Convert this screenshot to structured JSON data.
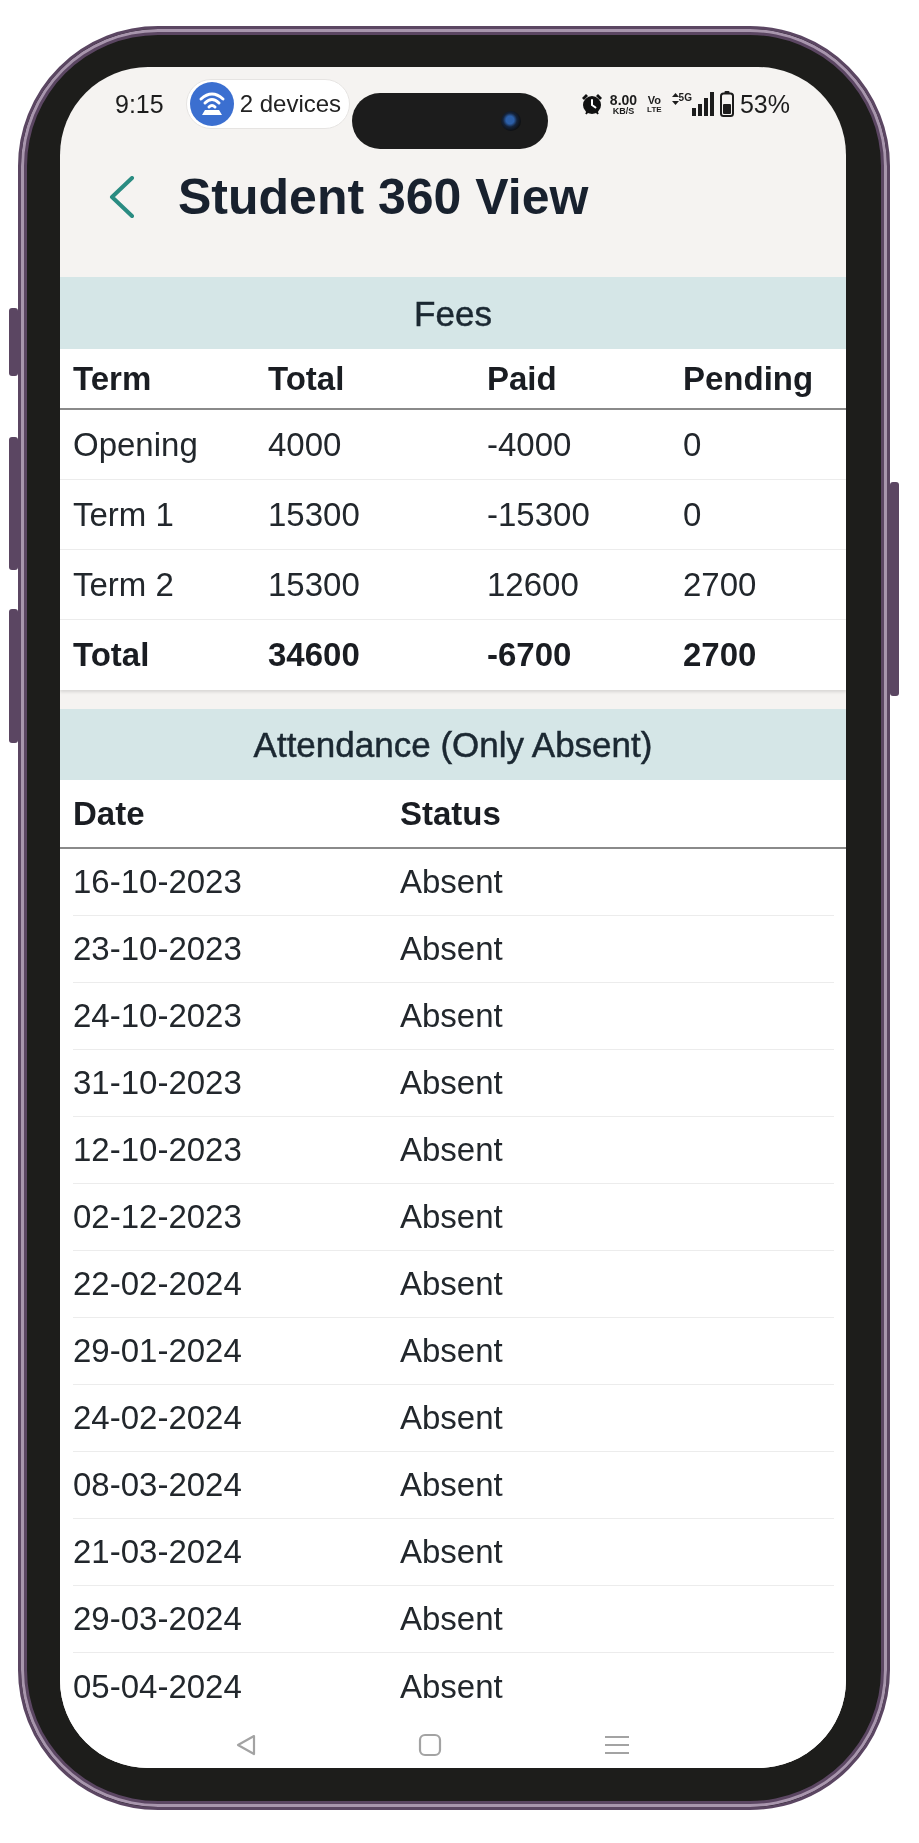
{
  "status_bar": {
    "time": "9:15",
    "hotspot": "2 devices",
    "speed_value": "8.00",
    "speed_unit": "KB/S",
    "volte_top": "Vo",
    "volte_bottom": "LTE",
    "network_type": "5G",
    "battery_percent": "53%"
  },
  "header": {
    "title": "Student 360 View"
  },
  "fees": {
    "title": "Fees",
    "columns": [
      "Term",
      "Total",
      "Paid",
      "Pending"
    ],
    "rows": [
      {
        "kind": "entry",
        "cells": [
          "Opening",
          "4000",
          "-4000",
          "0"
        ]
      },
      {
        "kind": "entry",
        "cells": [
          "Term 1",
          "15300",
          "-15300",
          "0"
        ]
      },
      {
        "kind": "entry",
        "cells": [
          "Term 2",
          "15300",
          "12600",
          "2700"
        ]
      },
      {
        "kind": "total",
        "cells": [
          "Total",
          "34600",
          "-6700",
          "2700"
        ]
      }
    ]
  },
  "attendance": {
    "title": "Attendance (Only Absent)",
    "columns": [
      "Date",
      "Status"
    ],
    "rows": [
      [
        "16-10-2023",
        "Absent"
      ],
      [
        "23-10-2023",
        "Absent"
      ],
      [
        "24-10-2023",
        "Absent"
      ],
      [
        "31-10-2023",
        "Absent"
      ],
      [
        "12-10-2023",
        "Absent"
      ],
      [
        "02-12-2023",
        "Absent"
      ],
      [
        "22-02-2024",
        "Absent"
      ],
      [
        "29-01-2024",
        "Absent"
      ],
      [
        "24-02-2024",
        "Absent"
      ],
      [
        "08-03-2024",
        "Absent"
      ],
      [
        "21-03-2024",
        "Absent"
      ],
      [
        "29-03-2024",
        "Absent"
      ],
      [
        "05-04-2024",
        "Absent"
      ]
    ]
  }
}
